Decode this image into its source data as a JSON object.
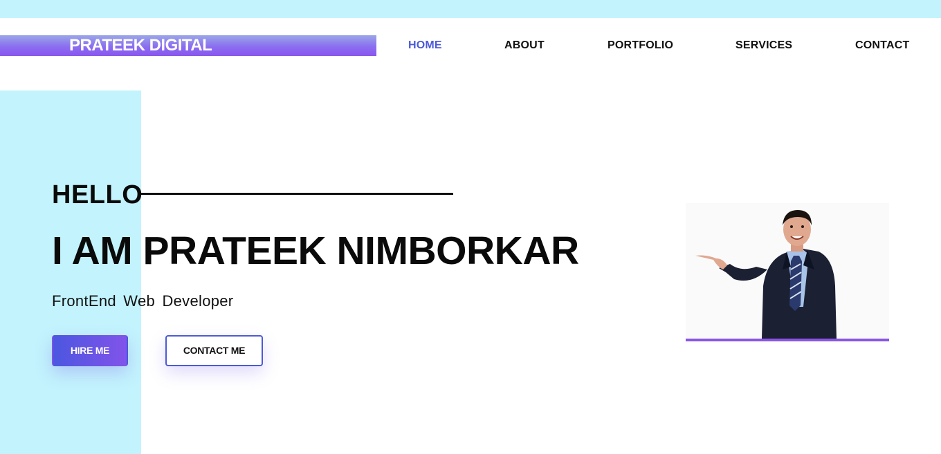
{
  "brand": {
    "name": "PRATEEK DIGITAL"
  },
  "nav": {
    "items": [
      {
        "label": "HOME",
        "active": true
      },
      {
        "label": "ABOUT",
        "active": false
      },
      {
        "label": "PORTFOLIO",
        "active": false
      },
      {
        "label": "SERVICES",
        "active": false
      },
      {
        "label": "CONTACT",
        "active": false
      }
    ]
  },
  "hero": {
    "greeting": "HELLO",
    "headline": "I AM PRATEEK NIMBORKAR",
    "subtitle": "FrontEnd Web Developer",
    "hire_button": "HIRE ME",
    "contact_button": "CONTACT ME",
    "image_icon": "businessman-pointing-photo"
  },
  "colors": {
    "accent": "#4a5ad8",
    "accent_purple": "#8b55e6",
    "cyan_panel": "#c3f3fd",
    "text": "#0a0a0a"
  }
}
